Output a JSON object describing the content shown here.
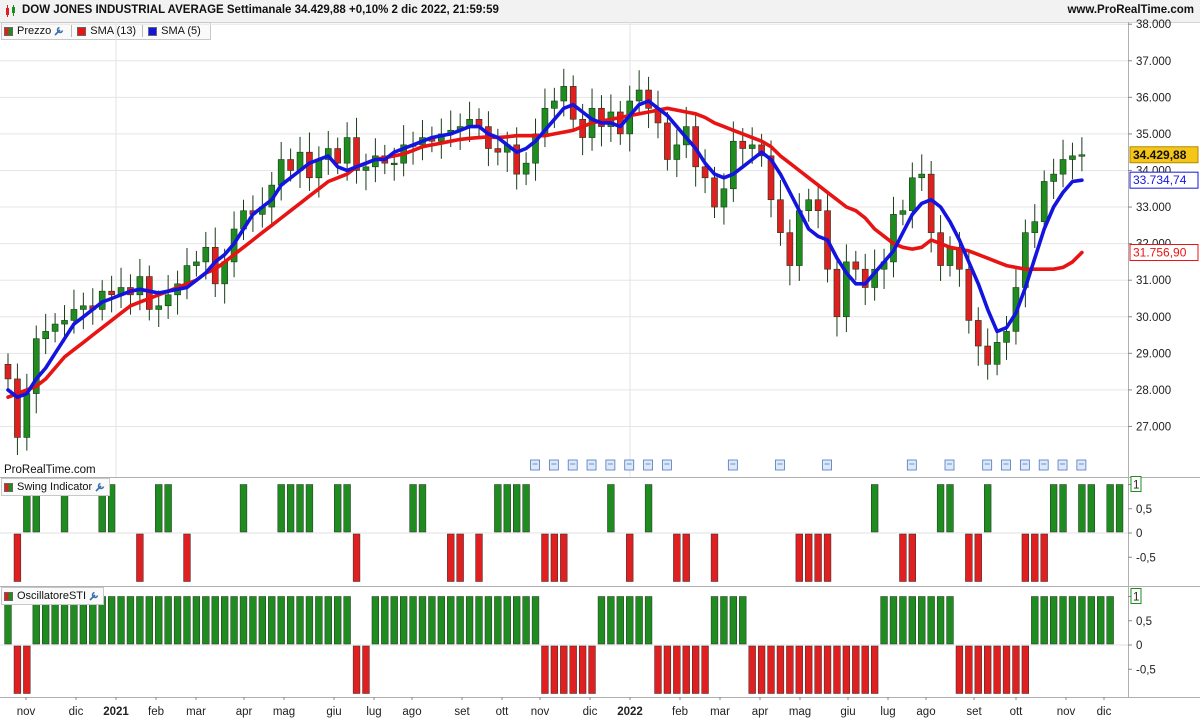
{
  "header": {
    "title": "DOW JONES INDUSTRIAL AVERAGE Settimanale 34.429,88 +0,10% 2 dic 2022, 21:59:59",
    "site": "www.ProRealTime.com",
    "icon": "candlestick-chart-icon"
  },
  "legend_price": {
    "price_label": "Prezzo",
    "sma13_label": "SMA (13)",
    "sma5_label": "SMA (5)"
  },
  "watermark": "ProRealTime.com",
  "swing_panel": {
    "label": "Swing Indicator"
  },
  "sti_panel": {
    "label": "OscillatoreSTI"
  },
  "colors": {
    "up": "#1e8c1e",
    "down": "#e02020",
    "sma13": "#e81414",
    "sma5": "#1414e0",
    "last_price_bg": "#f5c518"
  },
  "price_axis": {
    "ticks": [
      "38.000",
      "37.000",
      "36.000",
      "35.000",
      "34.000",
      "33.000",
      "32.000",
      "31.000",
      "30.000",
      "29.000",
      "28.000",
      "27.000"
    ],
    "last_price": "34.429,88",
    "sma5_value": "33.734,74",
    "sma13_value": "31.756,90"
  },
  "osc_axis": {
    "ticks": [
      "1",
      "0,5",
      "0",
      "-0,5"
    ]
  },
  "time_axis": {
    "labels": [
      "nov",
      "dic",
      "2021",
      "feb",
      "mar",
      "apr",
      "mag",
      "giu",
      "lug",
      "ago",
      "set",
      "ott",
      "nov",
      "dic",
      "2022",
      "feb",
      "mar",
      "apr",
      "mag",
      "giu",
      "lug",
      "ago",
      "set",
      "ott",
      "nov",
      "dic"
    ],
    "bold": [
      false,
      false,
      true,
      false,
      false,
      false,
      false,
      false,
      false,
      false,
      false,
      false,
      false,
      false,
      true,
      false,
      false,
      false,
      false,
      false,
      false,
      false,
      false,
      false,
      false,
      false
    ]
  },
  "chart_data": [
    {
      "type": "candlestick",
      "title": "DOW JONES INDUSTRIAL AVERAGE Settimanale",
      "period": "weekly",
      "x_start": "2020-10-26",
      "x_step_days": 7,
      "ylim": [
        26000,
        38300
      ],
      "close": [
        28300,
        26700,
        27900,
        29400,
        29600,
        29800,
        29900,
        30200,
        30300,
        30200,
        30700,
        30600,
        30800,
        30600,
        31100,
        30200,
        30300,
        30600,
        30900,
        31400,
        31500,
        31900,
        30900,
        31500,
        32400,
        32900,
        32800,
        33000,
        33600,
        34300,
        34000,
        34500,
        33800,
        34300,
        34600,
        34200,
        34900,
        34000,
        34100,
        34400,
        34200,
        34200,
        34700,
        34700,
        34900,
        34800,
        35000,
        35100,
        35200,
        35400,
        35200,
        34600,
        34500,
        34700,
        33900,
        34200,
        35000,
        35700,
        35900,
        36300,
        35400,
        34900,
        35700,
        35200,
        35600,
        35000,
        35900,
        36200,
        35700,
        35300,
        34300,
        34700,
        35200,
        34100,
        33800,
        33000,
        33500,
        34800,
        34600,
        34700,
        34400,
        33200,
        32300,
        31400,
        32900,
        33200,
        32900,
        31300,
        30000,
        31500,
        31300,
        30800,
        31300,
        31500,
        32800,
        32900,
        33800,
        33900,
        32300,
        31400,
        31900,
        31300,
        29900,
        29200,
        28700,
        29300,
        29600,
        30800,
        32300,
        32600,
        33700,
        33900,
        34300,
        34400,
        34430
      ],
      "open": [
        28700,
        28300,
        26700,
        27900,
        29400,
        29600,
        29800,
        29900,
        30200,
        30300,
        30200,
        30700,
        30600,
        30800,
        30600,
        31100,
        30200,
        30300,
        30600,
        30900,
        31400,
        31500,
        31900,
        30900,
        31500,
        32400,
        32900,
        32800,
        33000,
        33600,
        34300,
        34000,
        34500,
        33800,
        34300,
        34600,
        34200,
        34900,
        34000,
        34100,
        34400,
        34200,
        34200,
        34700,
        34700,
        34900,
        34800,
        35000,
        35100,
        35200,
        35400,
        35200,
        34600,
        34500,
        34700,
        33900,
        34200,
        35000,
        35700,
        35900,
        36300,
        35400,
        34900,
        35700,
        35200,
        35600,
        35000,
        35900,
        36200,
        35700,
        35300,
        34300,
        34700,
        35200,
        34100,
        33800,
        33000,
        33500,
        34800,
        34600,
        34700,
        34400,
        33200,
        32300,
        31400,
        32900,
        33200,
        32900,
        31300,
        30000,
        31500,
        31300,
        30800,
        31300,
        31500,
        32800,
        32900,
        33800,
        33900,
        32300,
        31400,
        31900,
        31300,
        29900,
        29200,
        28700,
        29300,
        29600,
        30800,
        32300,
        32600,
        33700,
        33900,
        34300,
        34400
      ],
      "sma13": [
        27800,
        27900,
        28000,
        28100,
        28300,
        28600,
        28900,
        29100,
        29300,
        29500,
        29700,
        29900,
        30100,
        30300,
        30400,
        30500,
        30600,
        30700,
        30800,
        30900,
        31000,
        31200,
        31300,
        31500,
        31700,
        31900,
        32100,
        32300,
        32500,
        32700,
        32900,
        33100,
        33300,
        33500,
        33700,
        33800,
        33900,
        34100,
        34200,
        34300,
        34350,
        34400,
        34450,
        34550,
        34650,
        34700,
        34750,
        34800,
        34850,
        34880,
        34900,
        34920,
        34900,
        34920,
        34950,
        34950,
        34950,
        34950,
        35000,
        35050,
        35100,
        35200,
        35300,
        35350,
        35400,
        35450,
        35500,
        35550,
        35600,
        35650,
        35700,
        35650,
        35600,
        35550,
        35450,
        35300,
        35200,
        35100,
        35000,
        34900,
        34800,
        34650,
        34400,
        34200,
        34000,
        33800,
        33600,
        33400,
        33200,
        33000,
        32900,
        32700,
        32400,
        32200,
        32000,
        31900,
        31850,
        31900,
        32100,
        32000,
        31900,
        31850,
        31800,
        31700,
        31600,
        31500,
        31400,
        31350,
        31300,
        31300,
        31300,
        31300,
        31350,
        31500,
        31757
      ],
      "sma5": [
        28000,
        27800,
        27900,
        28300,
        28600,
        29000,
        29400,
        29800,
        30000,
        30200,
        30400,
        30500,
        30600,
        30700,
        30750,
        30700,
        30650,
        30700,
        30750,
        30800,
        31000,
        31200,
        31500,
        31700,
        32000,
        32400,
        32800,
        33000,
        33200,
        33600,
        33800,
        34000,
        34200,
        34300,
        34400,
        34100,
        34000,
        34100,
        34200,
        34300,
        34300,
        34500,
        34600,
        34700,
        34800,
        34900,
        34950,
        35000,
        35100,
        35200,
        35200,
        35000,
        34900,
        34700,
        34500,
        34600,
        34800,
        35100,
        35400,
        35700,
        35800,
        35600,
        35400,
        35300,
        35300,
        35200,
        35500,
        35800,
        35900,
        35700,
        35500,
        35200,
        34900,
        34600,
        34200,
        33900,
        33800,
        33900,
        34100,
        34300,
        34500,
        34300,
        33900,
        33400,
        32900,
        32400,
        32200,
        32100,
        31600,
        31200,
        30900,
        30900,
        31200,
        31500,
        31800,
        32300,
        32800,
        33100,
        33200,
        33000,
        32600,
        32100,
        31500,
        30900,
        30200,
        29600,
        29700,
        30100,
        30800,
        31600,
        32400,
        33000,
        33400,
        33700,
        33735
      ]
    },
    {
      "type": "bar",
      "title": "Swing Indicator",
      "ylim": [
        -1,
        1
      ],
      "values": [
        0,
        -1,
        1,
        1,
        0,
        0,
        1,
        0,
        0,
        0,
        1,
        1,
        0,
        0,
        -1,
        0,
        1,
        1,
        0,
        -1,
        0,
        0,
        0,
        0,
        0,
        1,
        0,
        0,
        0,
        1,
        1,
        1,
        1,
        0,
        0,
        1,
        1,
        -1,
        0,
        0,
        0,
        0,
        0,
        1,
        1,
        0,
        0,
        -1,
        -1,
        0,
        -1,
        0,
        1,
        1,
        1,
        1,
        0,
        -1,
        -1,
        -1,
        0,
        0,
        0,
        0,
        1,
        0,
        -1,
        0,
        1,
        0,
        0,
        -1,
        -1,
        0,
        0,
        -1,
        0,
        0,
        0,
        0,
        0,
        0,
        0,
        0,
        -1,
        -1,
        -1,
        -1,
        0,
        0,
        0,
        0,
        1,
        0,
        0,
        -1,
        -1,
        0,
        0,
        1,
        1,
        0,
        -1,
        -1,
        1,
        0,
        0,
        0,
        -1,
        -1,
        -1,
        1,
        1,
        0,
        1,
        1,
        0,
        1,
        1
      ],
      "y_ticks": [
        "1",
        "0,5",
        "0",
        "-0,5"
      ]
    },
    {
      "type": "bar",
      "title": "OscillatoreSTI",
      "ylim": [
        -1,
        1
      ],
      "values": [
        1,
        -1,
        -1,
        1,
        1,
        1,
        1,
        1,
        1,
        1,
        1,
        1,
        1,
        1,
        1,
        1,
        1,
        1,
        1,
        1,
        1,
        1,
        1,
        1,
        1,
        1,
        1,
        1,
        1,
        1,
        1,
        1,
        1,
        1,
        1,
        1,
        1,
        -1,
        -1,
        1,
        1,
        1,
        1,
        1,
        1,
        1,
        1,
        1,
        1,
        1,
        1,
        1,
        1,
        1,
        1,
        1,
        1,
        -1,
        -1,
        -1,
        -1,
        -1,
        -1,
        1,
        1,
        1,
        1,
        1,
        1,
        -1,
        -1,
        -1,
        -1,
        -1,
        -1,
        1,
        1,
        1,
        1,
        -1,
        -1,
        -1,
        -1,
        -1,
        -1,
        -1,
        -1,
        -1,
        -1,
        -1,
        -1,
        -1,
        -1,
        1,
        1,
        1,
        1,
        1,
        1,
        1,
        1,
        -1,
        -1,
        -1,
        -1,
        -1,
        -1,
        -1,
        -1,
        1,
        1,
        1,
        1,
        1,
        1,
        1,
        1,
        1
      ],
      "y_ticks": [
        "1",
        "0,5",
        "0",
        "-0,5"
      ]
    }
  ]
}
